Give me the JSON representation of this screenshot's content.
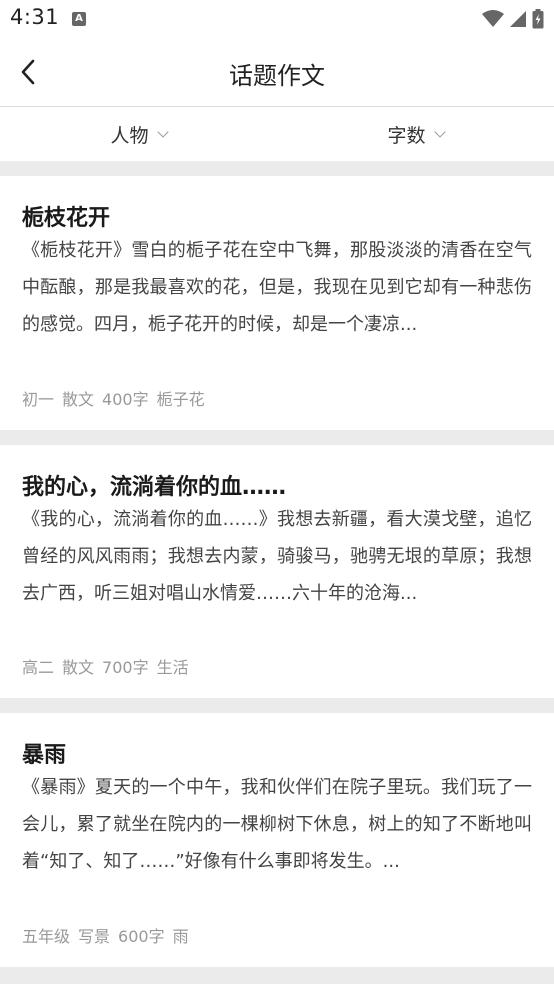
{
  "status_bar": {
    "time": "4:31",
    "app_icon_letter": "A",
    "icons": [
      "wifi-icon",
      "signal-icon",
      "battery-icon"
    ]
  },
  "header": {
    "title": "话题作文",
    "back_icon": "chevron-left-icon"
  },
  "filters": [
    {
      "label": "人物",
      "icon": "chevron-down-icon"
    },
    {
      "label": "字数",
      "icon": "chevron-down-icon"
    }
  ],
  "articles": [
    {
      "title": "栀枝花开",
      "excerpt": "《栀枝花开》雪白的栀子花在空中飞舞，那股淡淡的清香在空气中酝酿，那是我最喜欢的花，但是，我现在见到它却有一种悲伤的感觉。四月，栀子花开的时候，却是一个凄凉...",
      "grade": "初一",
      "genre": "散文",
      "words": "400字",
      "topic": "栀子花"
    },
    {
      "title": "我的心，流淌着你的血……",
      "excerpt": "《我的心，流淌着你的血……》我想去新疆，看大漠戈壁，追忆曾经的风风雨雨；我想去内蒙，骑骏马，驰骋无垠的草原；我想去广西，听三姐对唱山水情爱……六十年的沧海...",
      "grade": "高二",
      "genre": "散文",
      "words": "700字",
      "topic": "生活"
    },
    {
      "title": "暴雨",
      "excerpt": "《暴雨》夏天的一个中午，我和伙伴们在院子里玩。我们玩了一会儿，累了就坐在院内的一棵柳树下休息，树上的知了不断地叫着“知了、知了……”好像有什么事即将发生。...",
      "grade": "五年级",
      "genre": "写景",
      "words": "600字",
      "topic": "雨"
    }
  ],
  "colors": {
    "background": "#ebebeb",
    "card": "#ffffff",
    "meta_text": "#999999",
    "title_text": "#1a1a1a"
  }
}
